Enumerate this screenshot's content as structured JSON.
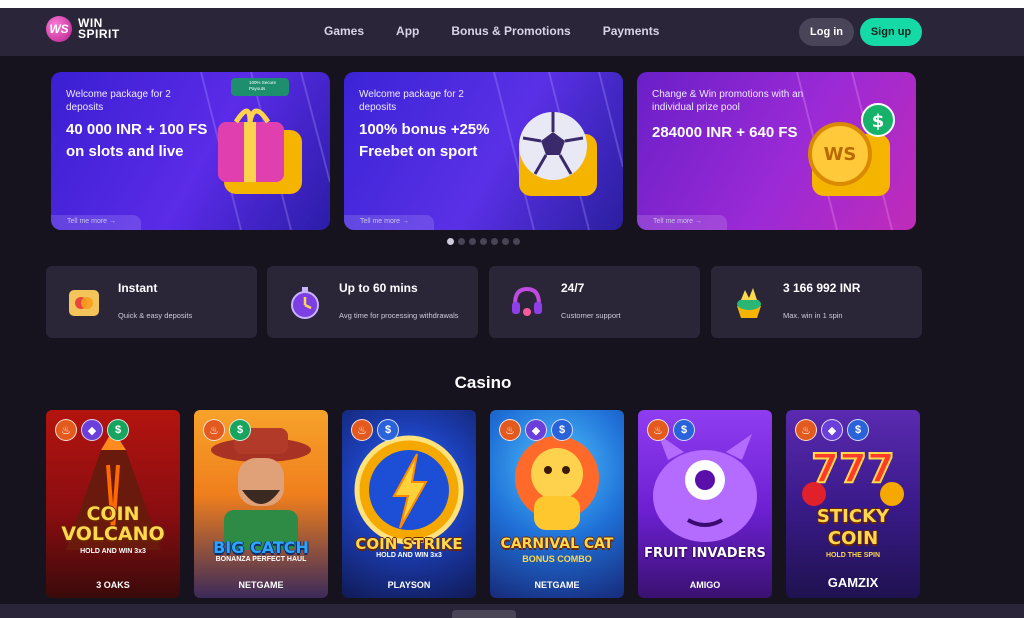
{
  "brand": {
    "logo_mark": "WS",
    "name_line1": "WIN",
    "name_line2": "SPIRIT"
  },
  "nav": {
    "items": [
      "Games",
      "App",
      "Bonus & Promotions",
      "Payments"
    ]
  },
  "auth": {
    "login": "Log in",
    "signup": "Sign up"
  },
  "banners": [
    {
      "subtitle": "Welcome package for 2 deposits",
      "title": "40 000 INR + 100 FS on slots and live",
      "more": "Tell me more →",
      "badge": "100% Secure Payouts"
    },
    {
      "subtitle": "Welcome package for 2 deposits",
      "title": "100% bonus +25% Freebet on sport",
      "more": "Tell me more →"
    },
    {
      "subtitle": "Change & Win promotions with an individual prize pool",
      "title": "284000 INR + 640 FS",
      "more": "Tell me more →"
    }
  ],
  "carousel": {
    "count": 7,
    "active": 0
  },
  "features": [
    {
      "title": "Instant",
      "subtitle": "Quick & easy deposits",
      "icon": "card-icon"
    },
    {
      "title": "Up to 60 mins",
      "subtitle": "Avg time for processing withdrawals",
      "icon": "stopwatch-icon"
    },
    {
      "title": "24/7",
      "subtitle": "Customer support",
      "icon": "headset-icon"
    },
    {
      "title": "3 166 992 INR",
      "subtitle": "Max. win in 1 spin",
      "icon": "treasure-icon"
    }
  ],
  "section": {
    "title": "Casino"
  },
  "games": [
    {
      "name": "COIN VOLCANO",
      "sub": "HOLD AND WIN 3x3",
      "provider": "3 OAKS",
      "tags": [
        "fire",
        "gem",
        "cash"
      ]
    },
    {
      "name": "BIG CATCH",
      "sub": "BONANZA PERFECT HAUL",
      "provider": "NETGAME",
      "tags": [
        "fire",
        "cash"
      ]
    },
    {
      "name": "COIN STRIKE",
      "sub": "HOLD AND WIN 3x3",
      "provider": "PLAYSON",
      "tags": [
        "fire",
        "bet"
      ]
    },
    {
      "name": "CARNIVAL CAT",
      "sub": "BONUS COMBO",
      "provider": "NETGAME",
      "tags": [
        "fire",
        "gem",
        "bet"
      ]
    },
    {
      "name": "FRUIT INVADERS",
      "sub": "",
      "provider": "AMIGO",
      "tags": [
        "fire",
        "bet"
      ]
    },
    {
      "name": "STICKY COIN",
      "sub": "HOLD THE SPIN",
      "provider": "GAMZIX",
      "tags": [
        "fire",
        "gem",
        "bet"
      ]
    }
  ],
  "colors": {
    "accent": "#16d9a8",
    "header": "#2a2538",
    "card": "#2a2638",
    "background": "#16131f"
  }
}
